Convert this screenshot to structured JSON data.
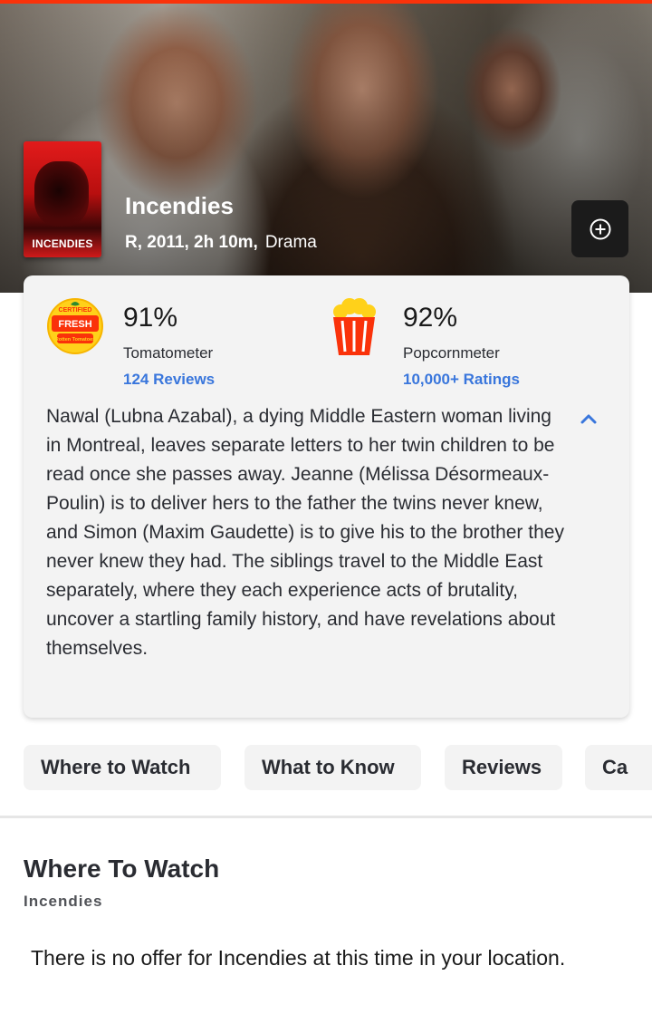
{
  "colors": {
    "accent": "#fa320a",
    "link_blue": "#3976dc",
    "card_bg": "#f3f3f3"
  },
  "movie": {
    "poster_title": "INCENDIES",
    "title": "Incendies",
    "meta_bold": "R, 2011, 2h 10m,",
    "genre": "Drama",
    "add_icon": "plus-circle-icon"
  },
  "tomatometer": {
    "badge_top": "CERTIFIED",
    "badge_main": "FRESH",
    "badge_bottom": "Rotten Tomatoes",
    "percent": "91%",
    "label": "Tomatometer",
    "count": "124 Reviews",
    "icon": "certified-fresh-icon"
  },
  "popcornmeter": {
    "percent": "92%",
    "label": "Popcornmeter",
    "count": "10,000+ Ratings",
    "icon": "popcorn-bucket-icon"
  },
  "synopsis": "Nawal (Lubna Azabal), a dying Middle Eastern woman living in Montreal, leaves separate letters to her twin children to be read once she passes away. Jeanne (Mélissa Désormeaux-Poulin) is to deliver hers to the father the twins never knew, and Simon (Maxim Gaudette) is to give his to the brother they never knew they had. The siblings travel to the Middle East separately, where they each experience acts of brutality, uncover a startling family history, and have revelations about themselves.",
  "tabs": [
    {
      "label": "Where to Watch"
    },
    {
      "label": "What to Know"
    },
    {
      "label": "Reviews"
    },
    {
      "label": "Ca"
    }
  ],
  "where_to_watch": {
    "title": "Where To Watch",
    "subtitle": "Incendies",
    "message": "There is no offer for Incendies at this time in your location."
  }
}
